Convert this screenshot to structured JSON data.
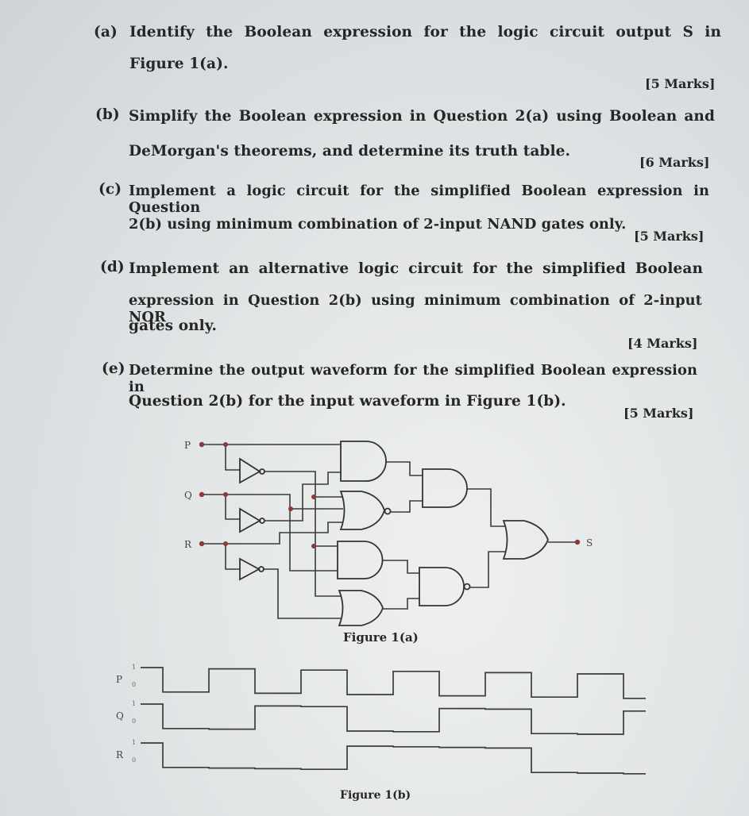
{
  "questions": [
    {
      "label": "(a)",
      "lines": [
        "Identify the Boolean expression for the logic circuit output S in",
        "Figure 1(a)."
      ],
      "marks": "[5 Marks]"
    },
    {
      "label": "(b)",
      "lines": [
        "Simplify the Boolean expression in Question 2(a) using Boolean and",
        "DeMorgan's theorems, and determine its truth table."
      ],
      "marks": "[6 Marks]"
    },
    {
      "label": "(c)",
      "lines": [
        "Implement a logic circuit for the simplified Boolean expression in Question",
        "2(b) using minimum combination of 2-input NAND gates only."
      ],
      "marks": "[5 Marks]"
    },
    {
      "label": "(d)",
      "lines": [
        "Implement an alternative logic circuit for the simplified Boolean",
        "expression in Question 2(b) using minimum combination of 2-input NOR",
        "gates only."
      ],
      "marks": "[4 Marks]"
    },
    {
      "label": "(e)",
      "lines": [
        "Determine the output waveform for the simplified Boolean expression in",
        "Question 2(b) for the input waveform in Figure 1(b)."
      ],
      "marks": "[5 Marks]"
    }
  ],
  "figure_a": {
    "caption": "Figure 1(a)",
    "inputs": [
      "P",
      "Q",
      "R"
    ],
    "output": "S",
    "gates": [
      "NOT P",
      "NOT Q",
      "NOT R",
      "AND",
      "NOR",
      "AND",
      "OR",
      "AND",
      "NAND",
      "OR"
    ]
  },
  "figure_b": {
    "caption": "Figure 1(b)",
    "level_high": "1",
    "level_low": "0",
    "signals": [
      {
        "name": "P",
        "levels": [
          1,
          0,
          1,
          0,
          1,
          0,
          1,
          0,
          1,
          0,
          1,
          0
        ]
      },
      {
        "name": "Q",
        "levels": [
          1,
          0,
          0,
          1,
          1,
          0,
          0,
          1,
          1,
          0,
          0,
          1
        ]
      },
      {
        "name": "R",
        "levels": [
          1,
          0,
          0,
          0,
          0,
          1,
          1,
          1,
          1,
          0,
          0,
          0
        ]
      }
    ]
  }
}
